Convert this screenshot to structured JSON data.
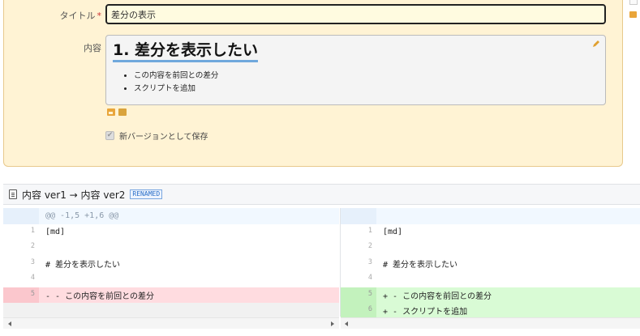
{
  "form": {
    "title_label": "タイトル",
    "required_mark": "*",
    "title_value": "差分の表示",
    "content_label": "内容",
    "content_heading": "1. 差分を表示したい",
    "content_items": [
      "この内容を前回との差分",
      "スクリプトを追加"
    ],
    "save_as_new_version_label": "新バージョンとして保存",
    "save_as_new_version_checked": true
  },
  "diff": {
    "title": "内容 ver1 → 内容 ver2",
    "badge": "RENAMED",
    "hunk_header": "@@ -1,5 +1,6 @@",
    "left": [
      {
        "num": "1",
        "code": "[md]",
        "type": "context"
      },
      {
        "num": "2",
        "code": "",
        "type": "context"
      },
      {
        "num": "3",
        "code": "# 差分を表示したい",
        "type": "context"
      },
      {
        "num": "4",
        "code": "",
        "type": "context"
      },
      {
        "num": "5",
        "code": "- - この内容を前回との差分",
        "type": "del"
      },
      {
        "num": "",
        "code": "",
        "type": "empty"
      }
    ],
    "right": [
      {
        "num": "1",
        "code": "[md]",
        "type": "context"
      },
      {
        "num": "2",
        "code": "",
        "type": "context"
      },
      {
        "num": "3",
        "code": "# 差分を表示したい",
        "type": "context"
      },
      {
        "num": "4",
        "code": "",
        "type": "context"
      },
      {
        "num": "5",
        "code": "+ - この内容を前回との差分",
        "type": "add"
      },
      {
        "num": "6",
        "code": "+ - スクリプトを追加",
        "type": "add"
      }
    ]
  },
  "icons": {
    "edit": "pencil-icon",
    "image": "image-icon",
    "file": "file-icon",
    "document": "document-icon"
  },
  "colors": {
    "form_bg": "#fff3d4",
    "deleted_bg": "#ffdce0",
    "added_bg": "#d9fbd5"
  }
}
